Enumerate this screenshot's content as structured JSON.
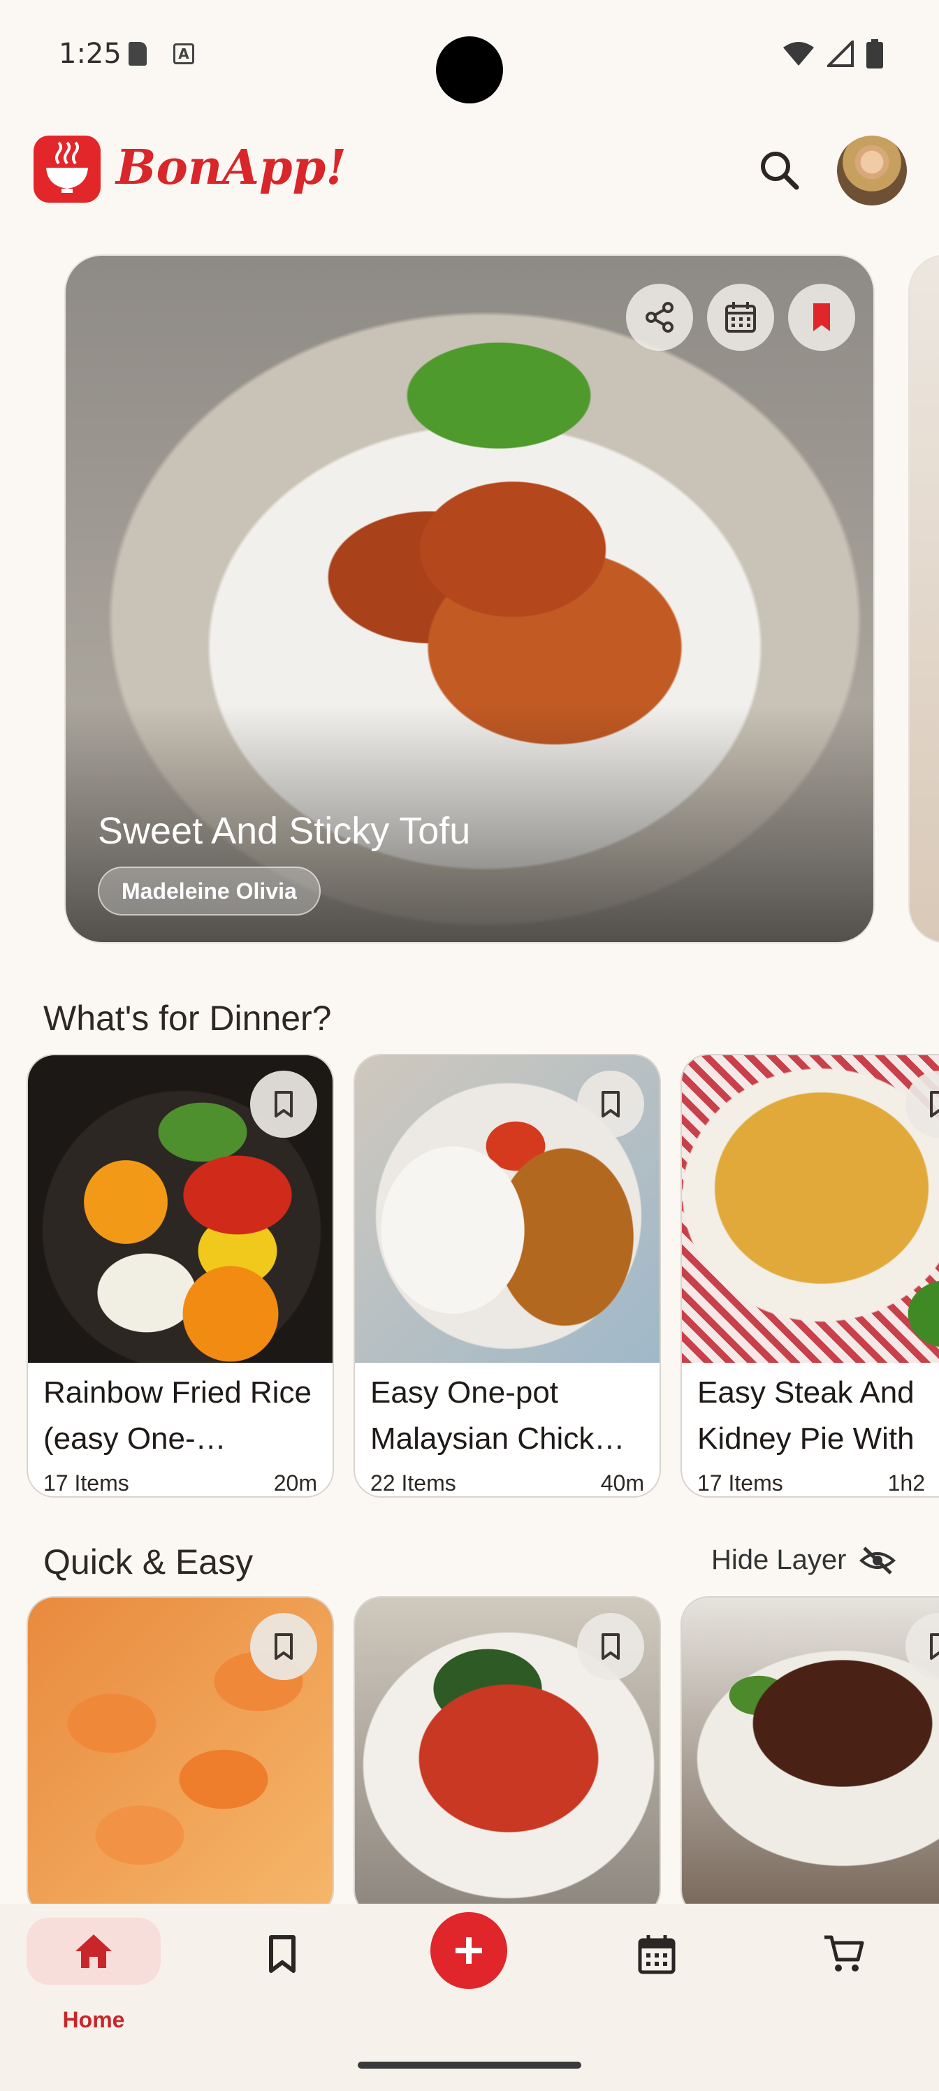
{
  "status_bar": {
    "time": "1:25",
    "a_badge": "A"
  },
  "header": {
    "brand": "BonApp!"
  },
  "hero": {
    "title": "Sweet And Sticky Tofu",
    "author": "Madeleine Olivia"
  },
  "sections": {
    "dinner": {
      "title": "What's for Dinner?",
      "cards": [
        {
          "name": "Rainbow Fried Rice (easy One-…",
          "items": "17 Items",
          "time": "20m"
        },
        {
          "name": "Easy One-pot Malaysian Chick…",
          "items": "22 Items",
          "time": "40m"
        },
        {
          "name": "Easy Steak And Kidney Pie With",
          "items": "17 Items",
          "time": "1h2"
        }
      ]
    },
    "quick": {
      "title": "Quick & Easy",
      "hide_label": "Hide Layer"
    }
  },
  "nav": {
    "home_label": "Home"
  },
  "colors": {
    "brand": "#E0262A",
    "background": "#FBF8F3",
    "nav_active_pill": "#F7DEDA"
  }
}
